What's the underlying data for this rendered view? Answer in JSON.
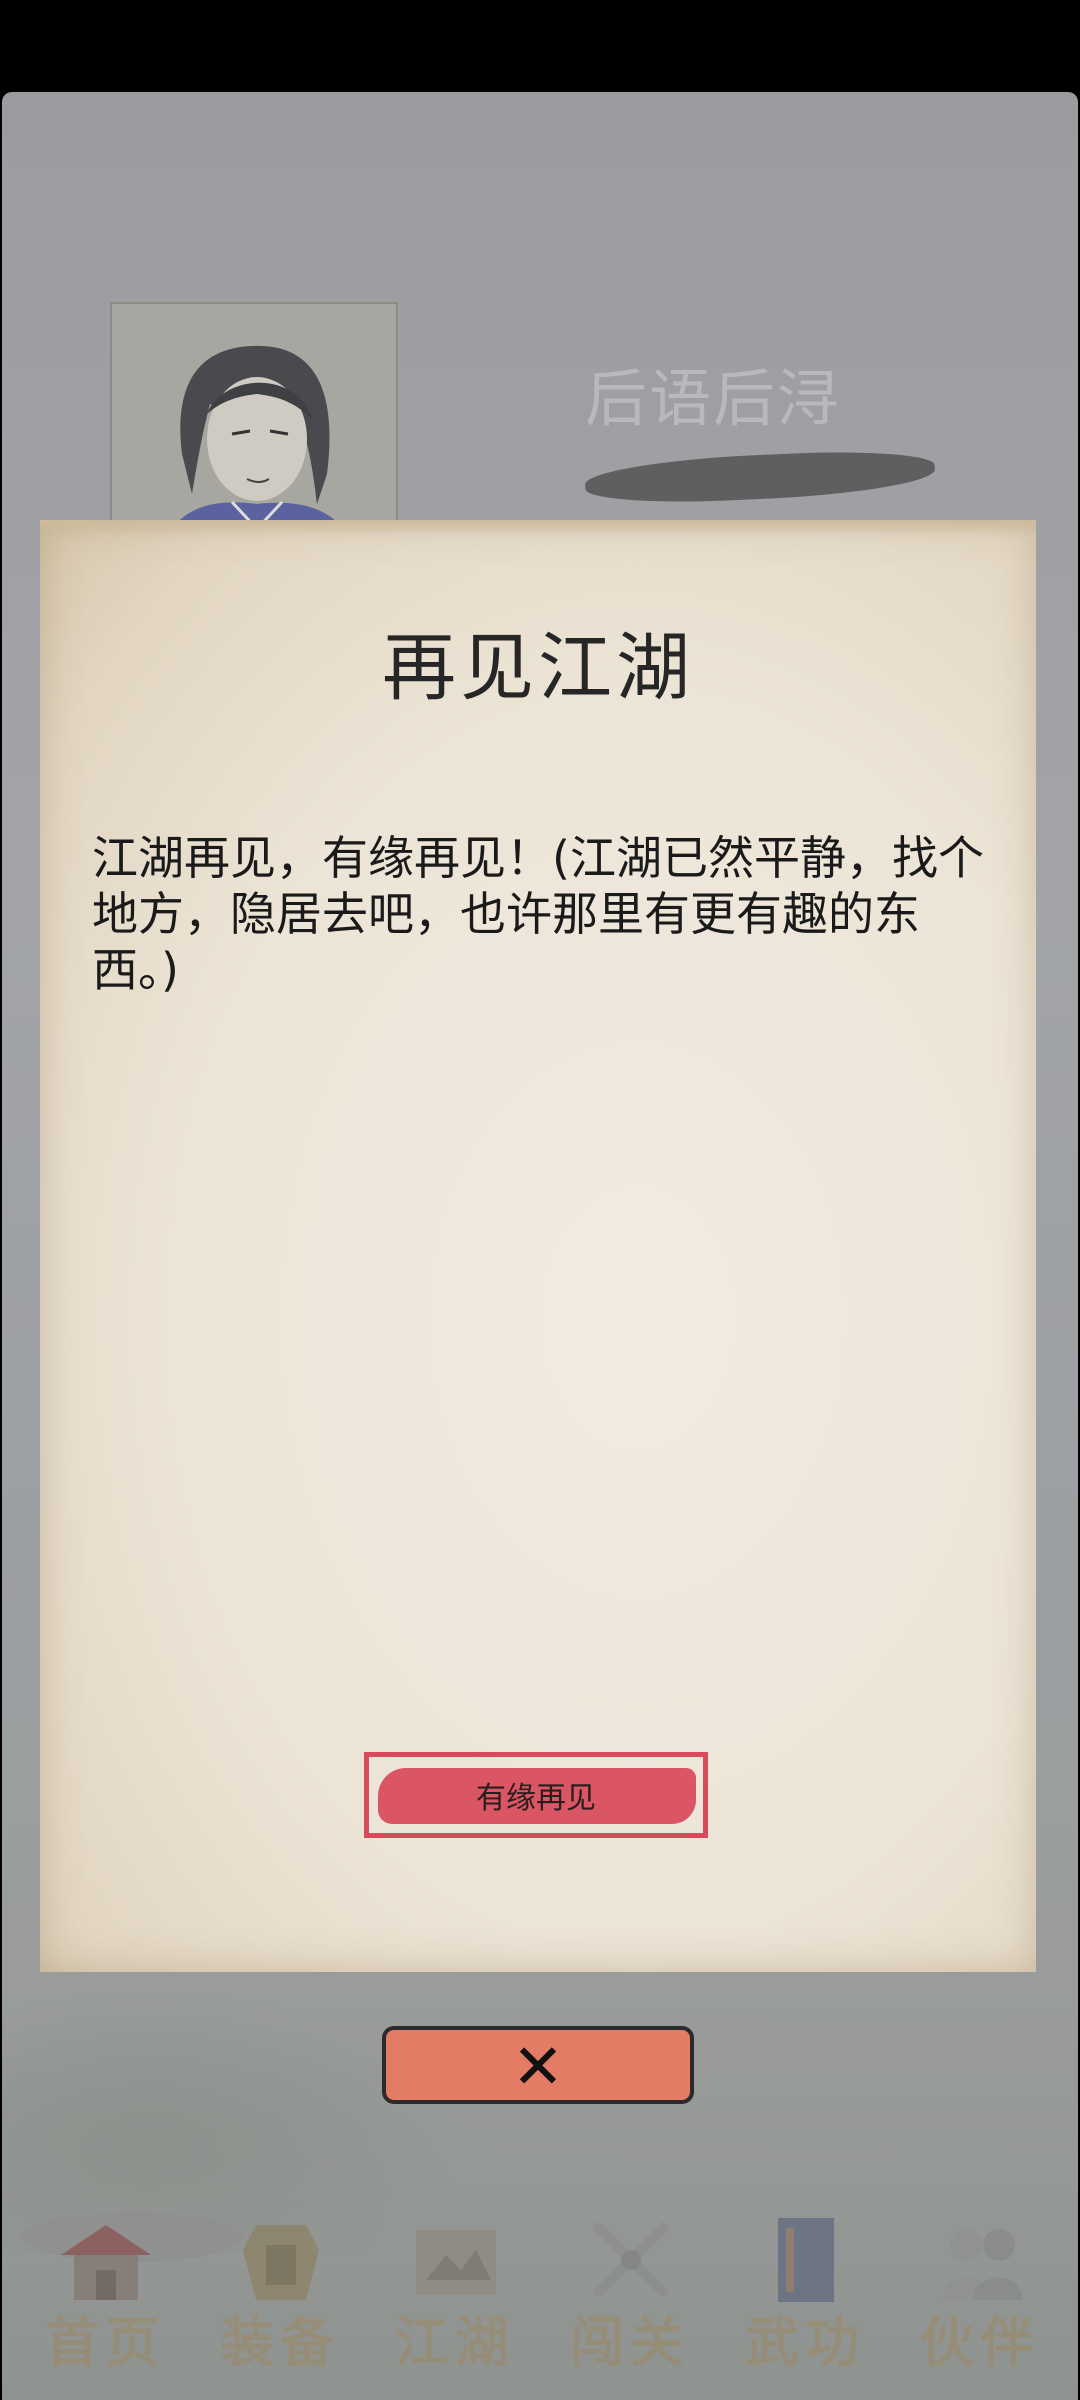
{
  "background": {
    "header_title": "后语后浔"
  },
  "dialog": {
    "title": "再见江湖",
    "body": "江湖再见，有缘再见！(江湖已然平静，找个地方，隐居去吧，也许那里有更有趣的东西。)",
    "confirm_label": "有缘再见"
  },
  "close_button": {
    "icon": "close-x-icon",
    "color": "#e47b64"
  },
  "bottom_nav": {
    "items": [
      {
        "label": "首页",
        "icon": "home-icon"
      },
      {
        "label": "装备",
        "icon": "armor-icon"
      },
      {
        "label": "江湖",
        "icon": "scroll-map-icon"
      },
      {
        "label": "闯关",
        "icon": "crossed-swords-icon"
      },
      {
        "label": "武功",
        "icon": "martial-book-icon"
      },
      {
        "label": "伙伴",
        "icon": "companions-icon"
      }
    ]
  },
  "colors": {
    "accent_red": "#d94a5c",
    "paper": "#ece4d6"
  }
}
